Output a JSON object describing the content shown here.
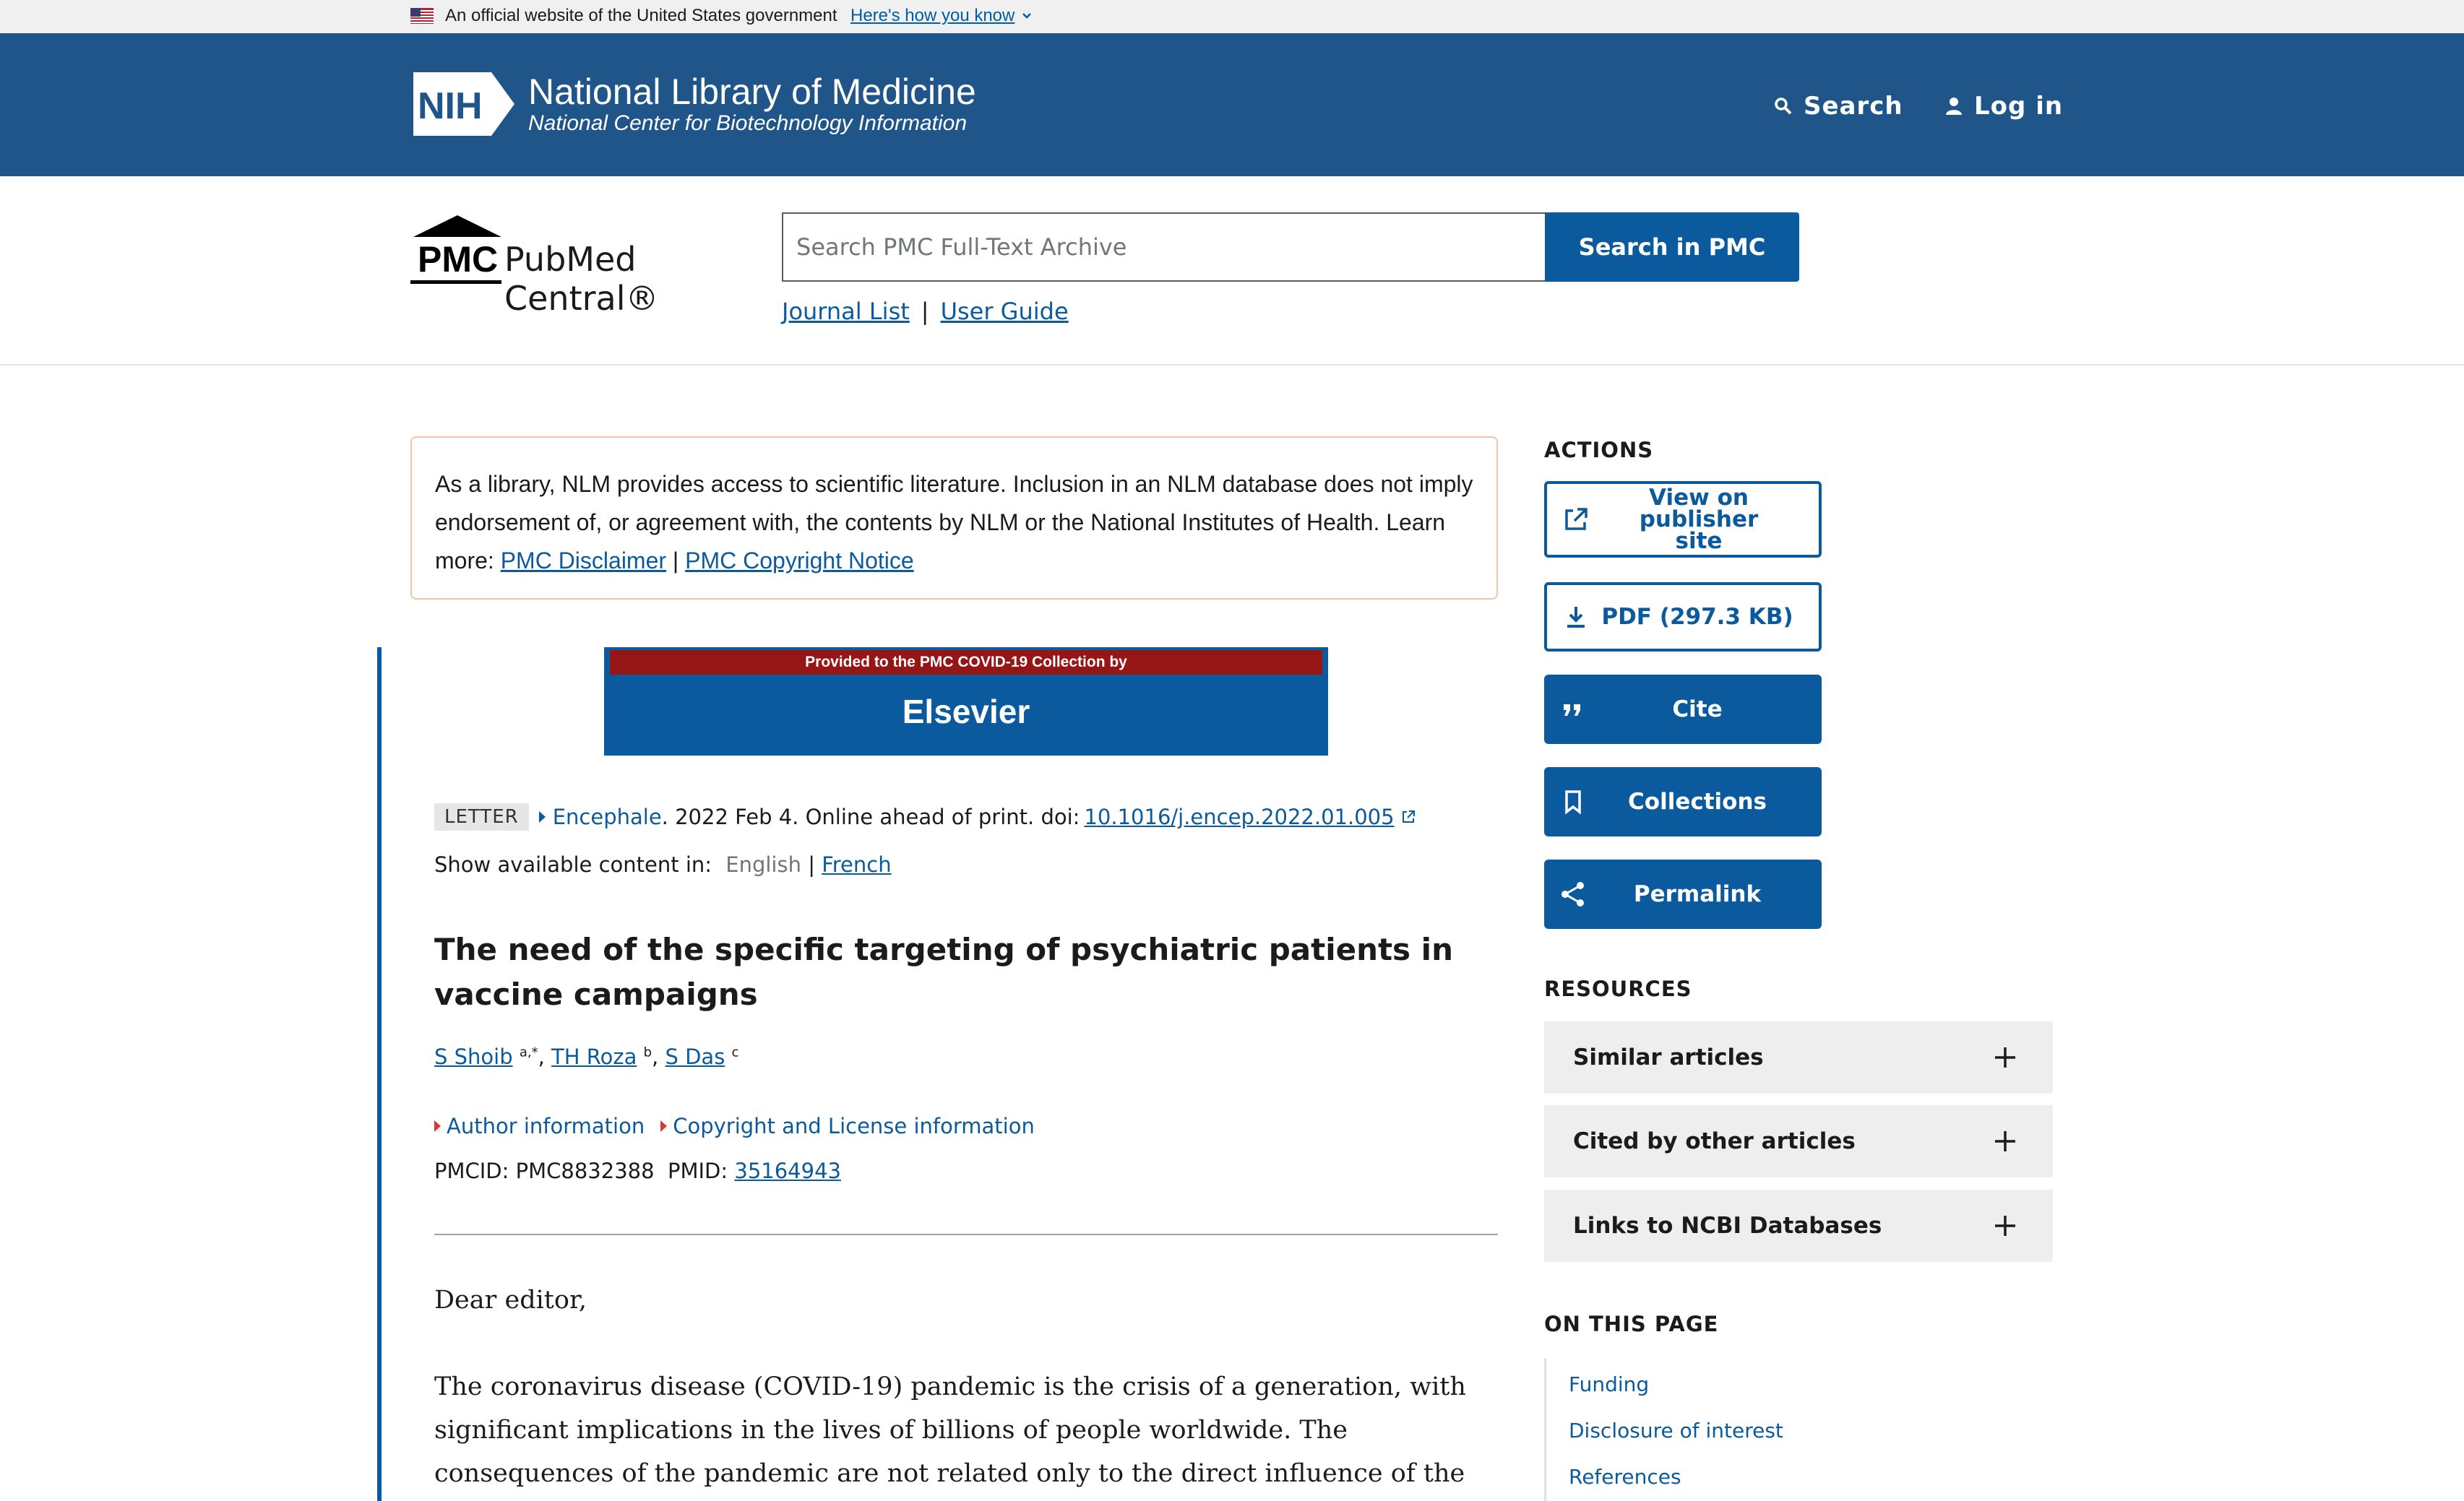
{
  "gov_banner": {
    "text": "An official website of the United States government",
    "link": "Here's how you know"
  },
  "header": {
    "logo": "NIH",
    "title": "National Library of Medicine",
    "subtitle": "National Center for Biotechnology Information",
    "search_label": "Search",
    "login_label": "Log in",
    "brand_color": "#20558a"
  },
  "pmc": {
    "logo_letters": "PMC",
    "logo_name": "PubMed Central®",
    "search_placeholder": "Search PMC Full-Text Archive",
    "search_button": "Search in PMC",
    "links": [
      "Journal List",
      "User Guide"
    ],
    "link_separator": "|"
  },
  "disclaimer": {
    "text": "As a library, NLM provides access to scientific literature. Inclusion in an NLM database does not imply endorsement of, or agreement with, the contents by NLM or the National Institutes of Health.",
    "learn_more": "Learn more:",
    "link1": "PMC Disclaimer",
    "sep": "|",
    "link2": "PMC Copyright Notice"
  },
  "elsevier_banner": {
    "top": "Provided to the PMC COVID-19 Collection by",
    "name": "Elsevier"
  },
  "article": {
    "type_tag": "LETTER",
    "journal": "Encephale",
    "date_text": ". 2022 Feb 4. Online ahead of print. doi: ",
    "doi": "10.1016/j.encep.2022.01.005",
    "lang_label": "Show available content in:",
    "lang_current": "English",
    "lang_sep": "|",
    "lang_other": "French",
    "title": "The need of the specific targeting of psychiatric patients in vaccine campaigns",
    "authors": [
      {
        "name": "S Shoib",
        "aff": "a,*"
      },
      {
        "name": "TH Roza",
        "aff": "b"
      },
      {
        "name": "S Das",
        "aff": "c"
      }
    ],
    "author_info": "Author information",
    "copyright_info": "Copyright and License information",
    "pmcid_label": "PMCID: PMC8832388",
    "pmid_label": "PMID:",
    "pmid": "35164943",
    "greeting": "Dear editor,",
    "paragraph": "The coronavirus disease (COVID-19) pandemic is the crisis of a generation, with significant implications in the lives of billions of people worldwide. The consequences of the pandemic are not related only to the direct influence of the virus and the infection, but also to the many"
  },
  "sidebar": {
    "actions_heading": "ACTIONS",
    "actions": [
      {
        "label": "View on publisher site",
        "icon": "external-link-icon"
      },
      {
        "label": "PDF (297.3 KB)",
        "icon": "download-icon"
      },
      {
        "label": "Cite",
        "icon": "quote-icon"
      },
      {
        "label": "Collections",
        "icon": "bookmark-icon"
      },
      {
        "label": "Permalink",
        "icon": "share-icon"
      }
    ],
    "resources_heading": "RESOURCES",
    "resources": [
      "Similar articles",
      "Cited by other articles",
      "Links to NCBI Databases"
    ],
    "on_this_page_heading": "ON THIS PAGE",
    "on_this_page": [
      "Funding",
      "Disclosure of interest",
      "References"
    ]
  }
}
